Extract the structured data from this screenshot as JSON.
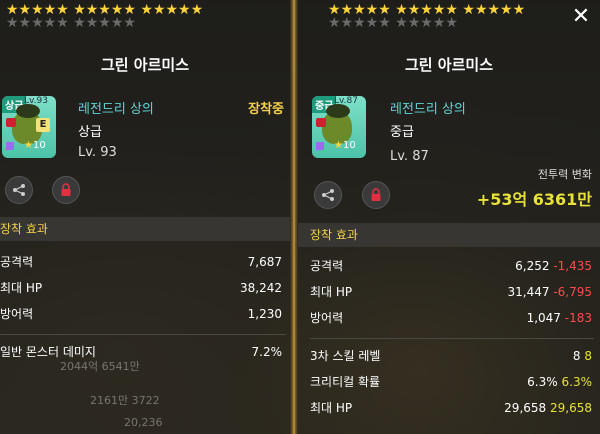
{
  "left": {
    "stars_top": "★★★★★ ★★★★★ ★★★★★",
    "stars_bottom": "★★★★★ ★★★★★",
    "title": "그린 아르미스",
    "icon": {
      "grade_tag": "상급",
      "level_tag": "Lv.93",
      "e_badge": "E",
      "star_count": "10"
    },
    "item_name": "레전드리 상의",
    "grade": "상급",
    "level": "Lv. 93",
    "equipped": "장착중",
    "section_title": "장착 효과",
    "stats": [
      {
        "label": "공격력",
        "value": "7,687"
      },
      {
        "label": "최대 HP",
        "value": "38,242"
      },
      {
        "label": "방어력",
        "value": "1,230"
      }
    ],
    "extra_stat": {
      "label": "일반 몬스터 데미지",
      "value": "7.2%"
    },
    "faded_lines": [
      "2044억 6541만",
      "2161만 3722",
      "20,236"
    ]
  },
  "right": {
    "stars_top": "★★★★★ ★★★★★ ★★★★★",
    "stars_bottom": "★★★★★ ★★★★★",
    "title": "그린 아르미스",
    "icon": {
      "grade_tag": "중급",
      "level_tag": "Lv.87",
      "star_count": "10"
    },
    "item_name": "레전드리 상의",
    "grade": "중급",
    "level": "Lv. 87",
    "power_label": "전투력 변화",
    "power_value": "+53억 6361만",
    "section_title": "장착 효과",
    "stats": [
      {
        "label": "공격력",
        "value": "6,252",
        "diff": "-1,435"
      },
      {
        "label": "최대 HP",
        "value": "31,447",
        "diff": "-6,795"
      },
      {
        "label": "방어력",
        "value": "1,047",
        "diff": "-183"
      }
    ],
    "potential": [
      {
        "label": "3차 스킬 레벨",
        "value": "8",
        "bonus": "8"
      },
      {
        "label": "크리티컬 확률",
        "value": "6.3%",
        "bonus": "6.3%"
      },
      {
        "label": "최대 HP",
        "value": "29,658",
        "bonus": "29,658"
      }
    ],
    "close": "✕"
  },
  "colors": {
    "accent_yellow": "#f2d24a",
    "item_name": "#5fd6d6",
    "negative": "#ff4a4a",
    "positive": "#e7e23a"
  },
  "icons": [
    "share-icon",
    "lock-icon",
    "close-icon",
    "star-icon"
  ]
}
